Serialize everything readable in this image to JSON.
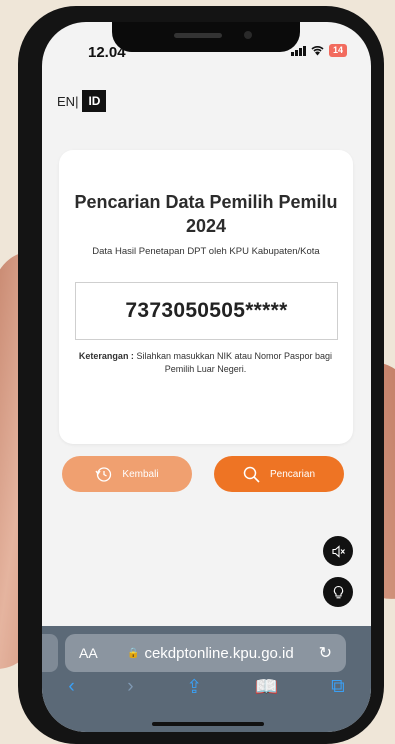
{
  "status_bar": {
    "time": "12.04",
    "battery": "14"
  },
  "language": {
    "en": "EN",
    "separator": "|",
    "id": "ID"
  },
  "card": {
    "title": "Pencarian Data Pemilih Pemilu 2024",
    "subtitle": "Data Hasil Penetapan DPT oleh KPU Kabupaten/Kota",
    "nik_value": "7373050505*****",
    "note_label": "Keterangan :",
    "note_text": "Silahkan masukkan NIK atau Nomor Paspor bagi Pemilih Luar Negeri."
  },
  "buttons": {
    "back": "Kembali",
    "search": "Pencarian"
  },
  "browser": {
    "text_size": "AA",
    "url": "cekdptonline.kpu.go.id",
    "reload": "↻",
    "toolbar": {
      "back": "‹",
      "forward": "›",
      "share": "⇪",
      "bookmarks": "📖",
      "tabs": "⧉"
    }
  },
  "colors": {
    "accent": "#ee7424",
    "accent_light": "#f0a070",
    "browser_bar": "#5b6977"
  },
  "icons": [
    "clock-back-icon",
    "search-icon",
    "mute-icon",
    "lightbulb-icon",
    "lock-icon"
  ]
}
